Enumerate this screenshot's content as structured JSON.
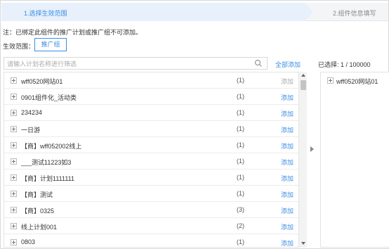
{
  "steps": {
    "step1": "1.选择生效范围",
    "step2": "2.组件信息填写"
  },
  "note": "注：已绑定此组件的推广计划或推广组不可添加。",
  "scope": {
    "label": "生效范围：",
    "button": "推广组"
  },
  "search": {
    "placeholder": "请输入计划名称进行筛选"
  },
  "add_all": "全部添加",
  "selected": {
    "label": "已选择: 1 / 100000",
    "items": [
      {
        "name": "wff0520网站01"
      }
    ]
  },
  "rows": [
    {
      "name": "wff0520网站01",
      "count": "(1)",
      "action": "添加",
      "disabled": true
    },
    {
      "name": "0901组件化_活动类",
      "count": "(1)",
      "action": "添加",
      "disabled": false
    },
    {
      "name": "234234",
      "count": "(1)",
      "action": "添加",
      "disabled": false
    },
    {
      "name": "一日游",
      "count": "(1)",
      "action": "添加",
      "disabled": false
    },
    {
      "name": "【商】wff052002线上",
      "count": "(1)",
      "action": "添加",
      "disabled": false
    },
    {
      "name": "___测试11223如3",
      "count": "(1)",
      "action": "添加",
      "disabled": false
    },
    {
      "name": "【商】计划1111111",
      "count": "(1)",
      "action": "添加",
      "disabled": false
    },
    {
      "name": "【商】测试",
      "count": "(1)",
      "action": "添加",
      "disabled": false
    },
    {
      "name": "【商】0325",
      "count": "(3)",
      "action": "添加",
      "disabled": false
    },
    {
      "name": "线上计划001",
      "count": "(2)",
      "action": "添加",
      "disabled": false
    },
    {
      "name": "0803",
      "count": "(1)",
      "action": "添加",
      "disabled": false
    }
  ]
}
